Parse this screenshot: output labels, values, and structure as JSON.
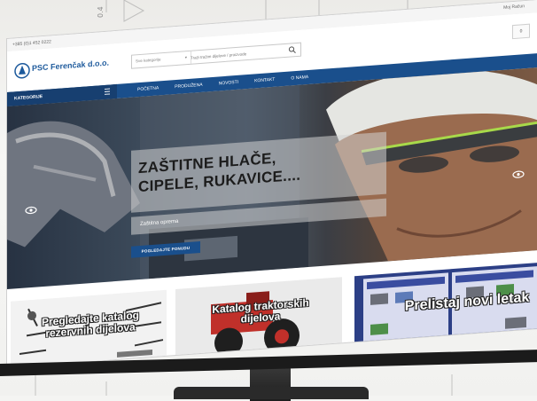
{
  "site": {
    "phone": "+385 (0)1 452 0222",
    "account": "Moj Račun"
  },
  "header": {
    "logo_text": "PSC Ferenčak d.o.o.",
    "search_category": "Sve kategorije",
    "search_placeholder": "Traži tražim dijelove / proizvode",
    "right_box": "0"
  },
  "nav": {
    "categories_label": "KATEGORIJE",
    "items": [
      "POČETNA",
      "PRODUŽENA",
      "NOVOSTI",
      "KONTAKT",
      "O NAMA"
    ]
  },
  "hero": {
    "title_line1": "ZAŠTITNE HLAČE,",
    "title_line2": "CIPELE, RUKAVICE....",
    "subtitle": "Zaštitna oprema",
    "button": "POGLEDAJTE PONUDU"
  },
  "tiles": [
    {
      "label": "Pregledajte katalog rezervnih dijelova"
    },
    {
      "label": "Katalog traktorskih dijelova"
    },
    {
      "label": "Prelistaj novi letak"
    }
  ],
  "colors": {
    "brand_blue": "#1a4f8c",
    "dark_blue": "#173f70",
    "catalog_blue": "#2c3f86"
  }
}
